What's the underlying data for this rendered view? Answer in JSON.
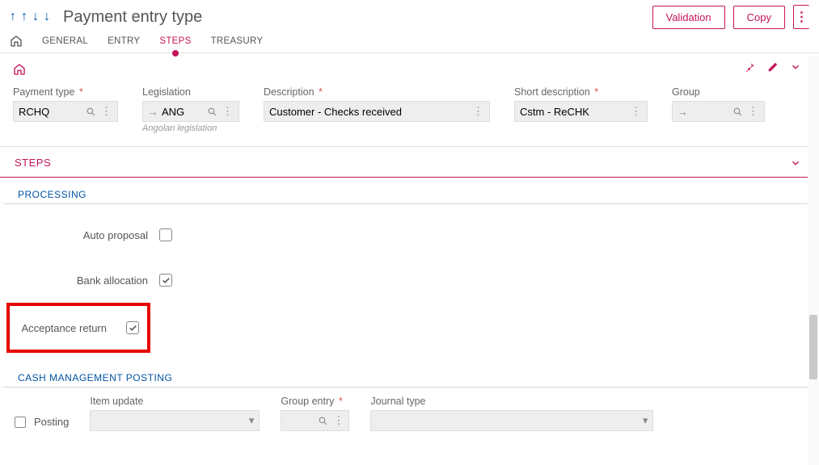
{
  "header": {
    "title": "Payment entry type",
    "actions": {
      "validation": "Validation",
      "copy": "Copy"
    }
  },
  "tabs": {
    "general": "GENERAL",
    "entry": "ENTRY",
    "steps": "STEPS",
    "treasury": "TREASURY"
  },
  "fields": {
    "payment_type": {
      "label": "Payment type",
      "value": "RCHQ"
    },
    "legislation": {
      "label": "Legislation",
      "value": "ANG",
      "help": "Angolan legislation"
    },
    "description": {
      "label": "Description",
      "value": "Customer - Checks received"
    },
    "short_description": {
      "label": "Short description",
      "value": "Cstm - ReCHK"
    },
    "group": {
      "label": "Group",
      "value": ""
    }
  },
  "sections": {
    "steps": "STEPS",
    "processing": "PROCESSING",
    "cash": "CASH MANAGEMENT POSTING"
  },
  "processing": {
    "auto_proposal": "Auto proposal",
    "bank_allocation": "Bank allocation",
    "acceptance_return": "Acceptance return"
  },
  "cash": {
    "posting": "Posting",
    "item_update": "Item update",
    "group_entry": "Group entry",
    "journal_type": "Journal type"
  }
}
